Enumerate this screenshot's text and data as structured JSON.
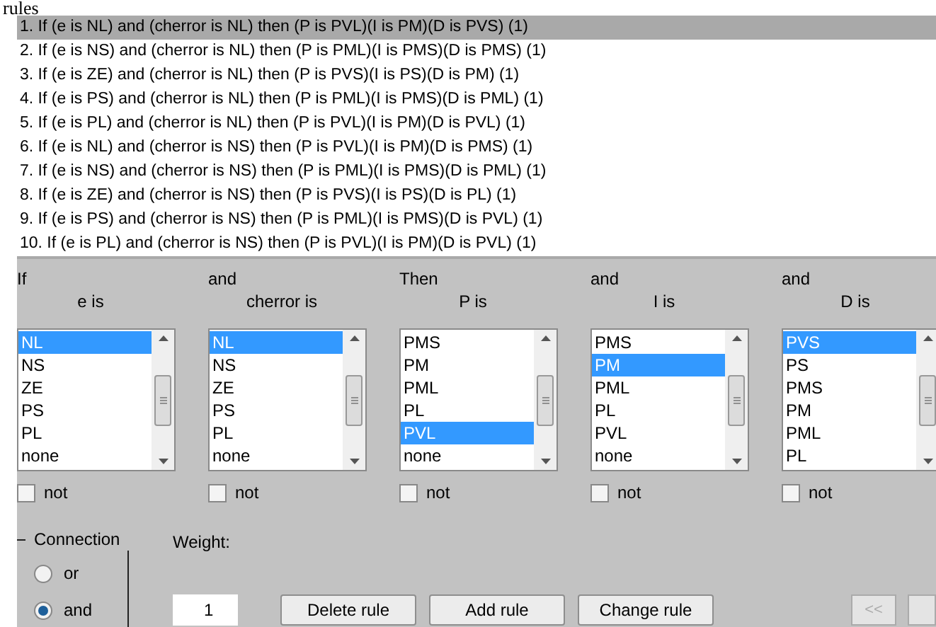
{
  "title": "rules",
  "rules": [
    {
      "text": "1. If (e is NL) and (cherror is NL) then (P is PVL)(I is PM)(D is PVS) (1)",
      "selected": true
    },
    {
      "text": "2. If (e is NS) and (cherror is NL) then (P is PML)(I is PMS)(D is PMS) (1)",
      "selected": false
    },
    {
      "text": "3. If (e is ZE) and (cherror is NL) then (P is PVS)(I is PS)(D is PM) (1)",
      "selected": false
    },
    {
      "text": "4. If (e is PS) and (cherror is NL) then (P is PML)(I is PMS)(D is PML) (1)",
      "selected": false
    },
    {
      "text": "5. If (e is PL) and (cherror is NL) then (P is PVL)(I is PM)(D is PVL) (1)",
      "selected": false
    },
    {
      "text": "6. If (e is NL) and (cherror is NS) then (P is PVL)(I is PM)(D is PMS) (1)",
      "selected": false
    },
    {
      "text": "7. If (e is NS) and (cherror is NS) then (P is PML)(I is PMS)(D is PML) (1)",
      "selected": false
    },
    {
      "text": "8. If (e is ZE) and (cherror is NS) then (P is PVS)(I is PS)(D is PL) (1)",
      "selected": false
    },
    {
      "text": "9. If (e is PS) and (cherror is NS) then (P is PML)(I is PMS)(D is PVL) (1)",
      "selected": false
    },
    {
      "text": "10. If (e is PL) and (cherror is NS) then (P is PVL)(I is PM)(D is PVL) (1)",
      "selected": false
    }
  ],
  "columns": [
    {
      "connector": "If",
      "label": "e is",
      "not": false,
      "options": [
        {
          "label": "NL",
          "selected": true
        },
        {
          "label": "NS",
          "selected": false
        },
        {
          "label": "ZE",
          "selected": false
        },
        {
          "label": "PS",
          "selected": false
        },
        {
          "label": "PL",
          "selected": false
        },
        {
          "label": "none",
          "selected": false
        }
      ],
      "not_label": "not"
    },
    {
      "connector": "and",
      "label": "cherror is",
      "not": false,
      "options": [
        {
          "label": "NL",
          "selected": true
        },
        {
          "label": "NS",
          "selected": false
        },
        {
          "label": "ZE",
          "selected": false
        },
        {
          "label": "PS",
          "selected": false
        },
        {
          "label": "PL",
          "selected": false
        },
        {
          "label": "none",
          "selected": false
        }
      ],
      "not_label": "not"
    },
    {
      "connector": "Then",
      "label": "P is",
      "not": false,
      "options": [
        {
          "label": "PMS",
          "selected": false
        },
        {
          "label": "PM",
          "selected": false
        },
        {
          "label": "PML",
          "selected": false
        },
        {
          "label": "PL",
          "selected": false
        },
        {
          "label": "PVL",
          "selected": true
        },
        {
          "label": "none",
          "selected": false
        }
      ],
      "not_label": "not"
    },
    {
      "connector": "and",
      "label": "I is",
      "not": false,
      "options": [
        {
          "label": "PMS",
          "selected": false
        },
        {
          "label": "PM",
          "selected": true
        },
        {
          "label": "PML",
          "selected": false
        },
        {
          "label": "PL",
          "selected": false
        },
        {
          "label": "PVL",
          "selected": false
        },
        {
          "label": "none",
          "selected": false
        }
      ],
      "not_label": "not"
    },
    {
      "connector": "and",
      "label": "D is",
      "not": false,
      "options": [
        {
          "label": "PVS",
          "selected": true
        },
        {
          "label": "PS",
          "selected": false
        },
        {
          "label": "PMS",
          "selected": false
        },
        {
          "label": "PM",
          "selected": false
        },
        {
          "label": "PML",
          "selected": false
        },
        {
          "label": "PL",
          "selected": false
        }
      ],
      "not_label": "not"
    }
  ],
  "connection": {
    "title": "Connection",
    "options": [
      {
        "label": "or",
        "selected": false
      },
      {
        "label": "and",
        "selected": true
      }
    ]
  },
  "weight": {
    "label": "Weight:",
    "value": "1"
  },
  "buttons": [
    "Delete rule",
    "Add rule",
    "Change rule"
  ],
  "nav_buttons": [
    {
      "label": "<<",
      "disabled": true
    }
  ]
}
